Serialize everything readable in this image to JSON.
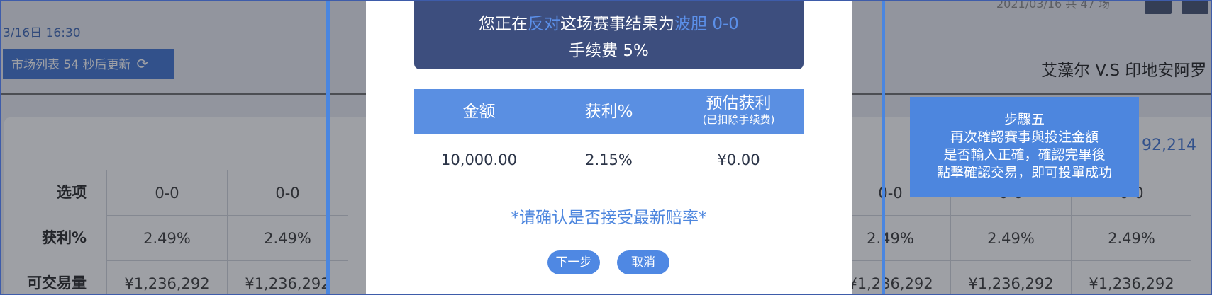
{
  "background": {
    "date_time": "3/16日 16:30",
    "top_right": "2021/03/16 共 47 场",
    "refresh_label": "市场列表 54 秒后更新",
    "refresh_icon": "refresh-icon",
    "match": "艾藻尔 V.S 印地安阿罗",
    "total": "92,214",
    "rows": [
      {
        "label": "选项",
        "cells": [
          "0-0",
          "0-0",
          "0-0",
          "0-0",
          "0-0"
        ]
      },
      {
        "label": "获利%",
        "cells": [
          "2.49%",
          "2.49%",
          "2.49%",
          "2.49%",
          "2.49%"
        ]
      },
      {
        "label": "可交易量",
        "cells": [
          "¥1,236,292",
          "¥1,236,292",
          "¥1,236,292",
          "¥1,236,292",
          "¥1,236,292"
        ]
      }
    ]
  },
  "modal": {
    "header": {
      "prefix": "您正在",
      "direction": "反对",
      "middle": "这场赛事结果为",
      "market": "波胆 0-0",
      "fee": "手续费 5%"
    },
    "table": {
      "col_amount": "金额",
      "col_profit": "获利%",
      "col_estimated": "预估获利",
      "col_estimated_sub": "(已扣除手续费)",
      "amount": "10,000.00",
      "profit": "2.15%",
      "estimated": "¥0.00"
    },
    "notice": "*请确认是否接受最新赔率*",
    "next_label": "下一步",
    "cancel_label": "取消"
  },
  "callout": {
    "title": "步驟五",
    "line1": "再次確認賽事與投注金額",
    "line2": "是否輸入正確，確認完畢後",
    "line3": "點擊確認交易，即可投單成功"
  },
  "colors": {
    "accent": "#4d86de",
    "header_bg": "#3d4e7e"
  }
}
